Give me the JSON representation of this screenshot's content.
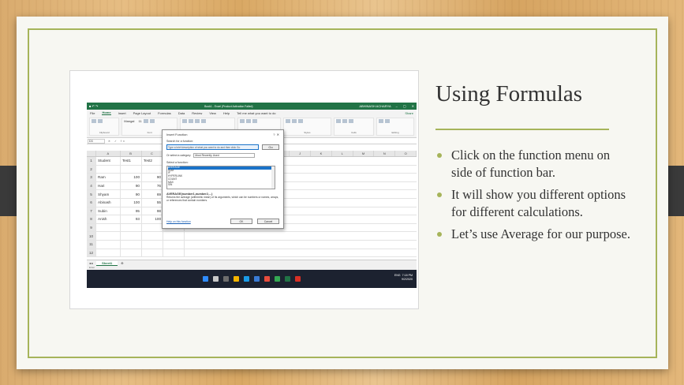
{
  "slide": {
    "title": "Using Formulas",
    "bullets": [
      "Click on the function menu on side of function bar.",
      "It will show you different options for different calculations.",
      "Let’s use Average for our purpose."
    ],
    "accent_color": "#a6b45a"
  },
  "excel": {
    "window_title": "Book1 - Excel (Product Activation Failed)",
    "user": "ABHINASH ACHARYA",
    "ribbon_tabs": [
      "File",
      "Home",
      "Insert",
      "Page Layout",
      "Formulas",
      "Data",
      "Review",
      "View",
      "Help",
      "Tell me what you want to do"
    ],
    "share": "Share",
    "groups": [
      "Clipboard",
      "Font",
      "Alignment",
      "Number",
      "Styles",
      "Cells",
      "Editing"
    ],
    "name_box": "D3",
    "font_name": "Mangal",
    "font_size": "11",
    "columns": [
      "",
      "A",
      "B",
      "C",
      "D",
      "E",
      "F",
      "G",
      "H",
      "I",
      "J",
      "K",
      "L",
      "M",
      "N",
      "O"
    ],
    "rows": [
      [
        "1",
        "Student",
        "Test1",
        "Test2",
        ""
      ],
      [
        "2",
        "",
        "",
        "",
        ""
      ],
      [
        "3",
        "Ram",
        "100",
        "90",
        ""
      ],
      [
        "4",
        "Hari",
        "90",
        "76",
        ""
      ],
      [
        "5",
        "Shyam",
        "90",
        "69",
        ""
      ],
      [
        "6",
        "Abinash",
        "100",
        "55",
        ""
      ],
      [
        "7",
        "Subin",
        "95",
        "98",
        ""
      ],
      [
        "8",
        "Anish",
        "93",
        "100",
        ""
      ],
      [
        "9",
        "",
        "",
        "",
        ""
      ],
      [
        "10",
        "",
        "",
        "",
        ""
      ],
      [
        "11",
        "",
        "",
        "",
        ""
      ],
      [
        "12",
        "",
        "",
        "",
        ""
      ]
    ],
    "sheet_tab": "Sheet1",
    "status": "Enter",
    "tray_lang": "ENG",
    "tray_time": "7:18 PM",
    "tray_date": "9/2/2020"
  },
  "dialog": {
    "title": "Insert Function",
    "search_label": "Search for a function:",
    "search_placeholder": "Type a brief description of what you want to do and then click Go",
    "go": "Go",
    "category_label": "Or select a category:",
    "category_value": "Most Recently Used",
    "select_label": "Select a function:",
    "functions": [
      "AVERAGE",
      "SUM",
      "IF",
      "HYPERLINK",
      "COUNT",
      "MAX",
      "SIN"
    ],
    "signature": "AVERAGE(number1,number2,...)",
    "description": "Returns the average (arithmetic mean) of its arguments, which can be numbers or names, arrays, or references that contain numbers.",
    "help_link": "Help on this function",
    "ok": "OK",
    "cancel": "Cancel"
  }
}
